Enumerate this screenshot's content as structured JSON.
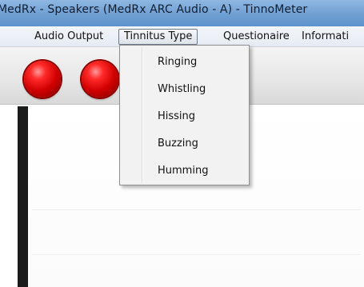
{
  "window": {
    "title": "MedRx - Speakers (MedRx ARC Audio - A) - TinnoMeter"
  },
  "menubar": {
    "items": [
      {
        "label": "Audio Output"
      },
      {
        "label": "Tinnitus Type"
      },
      {
        "label": "Questionaire"
      },
      {
        "label": "Informati"
      }
    ],
    "active_item": "Tinnitus Type"
  },
  "toolbar": {
    "indicators": [
      {
        "name": "red-indicator-light",
        "color": "#e00000"
      },
      {
        "name": "red-indicator-light",
        "color": "#e00000"
      }
    ]
  },
  "tinnitus_type_menu": {
    "options": [
      {
        "label": "Ringing"
      },
      {
        "label": "Whistling"
      },
      {
        "label": "Hissing"
      },
      {
        "label": "Buzzing"
      },
      {
        "label": "Humming"
      }
    ]
  },
  "colors": {
    "title_bar": "#6f9fd2",
    "menu_bar": "#e6ebf3",
    "indicator_red": "#e00000",
    "side_bar": "#1b1b1b"
  }
}
